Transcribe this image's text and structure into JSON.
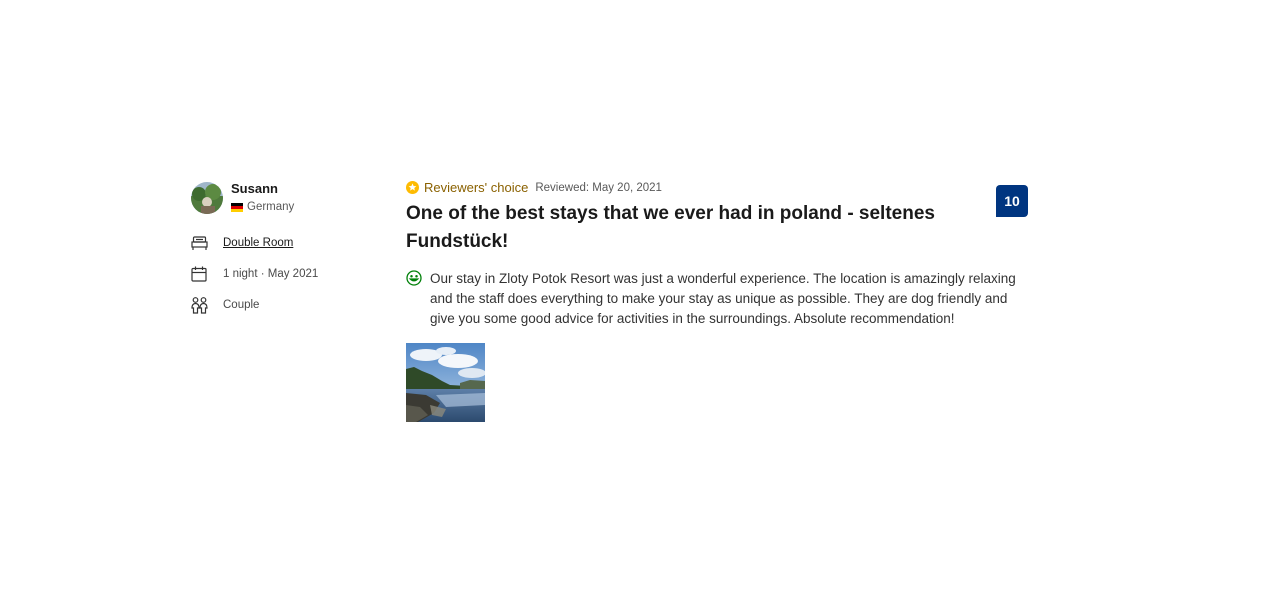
{
  "reviewer": {
    "name": "Susann",
    "country": "Germany",
    "avatar_icon": "avatar-photo"
  },
  "stay": {
    "room": "Double Room",
    "duration": "1 night · May 2021",
    "traveler_type": "Couple"
  },
  "review": {
    "badge_label": "Reviewers' choice",
    "reviewed_date": "Reviewed: May 20, 2021",
    "title": "One of the best stays that we ever had in poland - seltenes Fundstück!",
    "score": "10",
    "positive_text": "Our stay in Zloty Potok Resort was just a wonderful experience. The location is amazingly relaxing and the staff does everything to make your stay as unique as possible. They are dog friendly and give you some good advice for activities in the surroundings. Absolute recommendation!"
  },
  "colors": {
    "score_bg": "#003580",
    "badge_gold": "#febb02",
    "choice_text": "#8a6100",
    "positive_green": "#008009"
  },
  "icons": {
    "bed": "bed-icon",
    "calendar": "calendar-icon",
    "people": "people-icon",
    "star": "star-badge-icon",
    "smile": "smile-icon",
    "flag": "germany-flag-icon"
  }
}
